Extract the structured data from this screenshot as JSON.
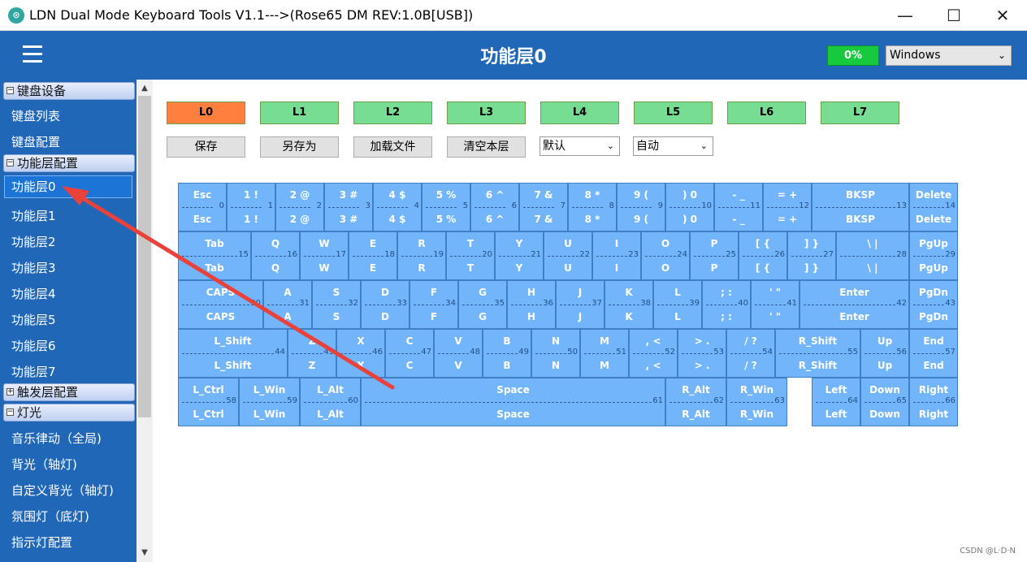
{
  "window": {
    "title": "LDN Dual Mode Keyboard Tools V1.1--->(Rose65 DM REV:1.0B[USB])",
    "minimize": "—",
    "maximize": "☐",
    "close": "✕"
  },
  "header": {
    "page_title": "功能层0",
    "progress": "0%",
    "os_select": "Windows"
  },
  "sidebar": {
    "groups": [
      {
        "label": "键盘设备",
        "toggle": "−"
      },
      {
        "label": "功能层配置",
        "toggle": "−"
      },
      {
        "label": "触发层配置",
        "toggle": "+"
      },
      {
        "label": "灯光",
        "toggle": "−"
      }
    ],
    "keyboard_items": [
      "键盘列表",
      "键盘配置"
    ],
    "layer_items": [
      "功能层0",
      "功能层1",
      "功能层2",
      "功能层3",
      "功能层4",
      "功能层5",
      "功能层6",
      "功能层7"
    ],
    "light_items": [
      "音乐律动（全局)",
      "背光（轴灯)",
      "自定义背光（轴灯)",
      "氛围灯（底灯)",
      "指示灯配置"
    ]
  },
  "layers": [
    {
      "label": "L0",
      "color": "#fe7f3e"
    },
    {
      "label": "L1",
      "color": "#76dd92"
    },
    {
      "label": "L2",
      "color": "#76dd92"
    },
    {
      "label": "L3",
      "color": "#76dd92"
    },
    {
      "label": "L4",
      "color": "#76dd92"
    },
    {
      "label": "L5",
      "color": "#76dd92"
    },
    {
      "label": "L6",
      "color": "#76dd92"
    },
    {
      "label": "L7",
      "color": "#76dd92"
    }
  ],
  "actions": {
    "save": "保存",
    "save_as": "另存为",
    "load_file": "加载文件",
    "clear_layer": "清空本层",
    "mode_select": "默认",
    "auto_select": "自动"
  },
  "keys": [
    {
      "top": "Esc",
      "bottom": "Esc",
      "num": "0"
    },
    {
      "top": "1 !",
      "bottom": "1 !",
      "num": "1"
    },
    {
      "top": "2 @",
      "bottom": "2 @",
      "num": "2"
    },
    {
      "top": "3 #",
      "bottom": "3 #",
      "num": "3"
    },
    {
      "top": "4 $",
      "bottom": "4 $",
      "num": "4"
    },
    {
      "top": "5 %",
      "bottom": "5 %",
      "num": "5"
    },
    {
      "top": "6 ^",
      "bottom": "6 ^",
      "num": "6"
    },
    {
      "top": "7 &",
      "bottom": "7 &",
      "num": "7"
    },
    {
      "top": "8 *",
      "bottom": "8 *",
      "num": "8"
    },
    {
      "top": "9 (",
      "bottom": "9 (",
      "num": "9"
    },
    {
      "top": ") 0",
      "bottom": ") 0",
      "num": "10"
    },
    {
      "top": "- _",
      "bottom": "- _",
      "num": "11"
    },
    {
      "top": "= +",
      "bottom": "= +",
      "num": "12"
    },
    {
      "top": "BKSP",
      "bottom": "BKSP",
      "num": "13"
    },
    {
      "top": "Delete",
      "bottom": "Delete",
      "num": "14"
    },
    {
      "top": "Tab",
      "bottom": "Tab",
      "num": "15"
    },
    {
      "top": "Q",
      "bottom": "Q",
      "num": "16"
    },
    {
      "top": "W",
      "bottom": "W",
      "num": "17"
    },
    {
      "top": "E",
      "bottom": "E",
      "num": "18"
    },
    {
      "top": "R",
      "bottom": "R",
      "num": "19"
    },
    {
      "top": "T",
      "bottom": "T",
      "num": "20"
    },
    {
      "top": "Y",
      "bottom": "Y",
      "num": "21"
    },
    {
      "top": "U",
      "bottom": "U",
      "num": "22"
    },
    {
      "top": "I",
      "bottom": "I",
      "num": "23"
    },
    {
      "top": "O",
      "bottom": "O",
      "num": "24"
    },
    {
      "top": "P",
      "bottom": "P",
      "num": "25"
    },
    {
      "top": "[ {",
      "bottom": "[ {",
      "num": "26"
    },
    {
      "top": "] }",
      "bottom": "] }",
      "num": "27"
    },
    {
      "top": "\\ |",
      "bottom": "\\ |",
      "num": "28"
    },
    {
      "top": "PgUp",
      "bottom": "PgUp",
      "num": "29"
    },
    {
      "top": "CAPS",
      "bottom": "CAPS",
      "num": "30"
    },
    {
      "top": "A",
      "bottom": "A",
      "num": "31"
    },
    {
      "top": "S",
      "bottom": "S",
      "num": "32"
    },
    {
      "top": "D",
      "bottom": "D",
      "num": "33"
    },
    {
      "top": "F",
      "bottom": "F",
      "num": "34"
    },
    {
      "top": "G",
      "bottom": "G",
      "num": "35"
    },
    {
      "top": "H",
      "bottom": "H",
      "num": "36"
    },
    {
      "top": "J",
      "bottom": "J",
      "num": "37"
    },
    {
      "top": "K",
      "bottom": "K",
      "num": "38"
    },
    {
      "top": "L",
      "bottom": "L",
      "num": "39"
    },
    {
      "top": "; :",
      "bottom": "; :",
      "num": "40"
    },
    {
      "top": "' \"",
      "bottom": "' \"",
      "num": "41"
    },
    {
      "top": "Enter",
      "bottom": "Enter",
      "num": "42"
    },
    {
      "top": "PgDn",
      "bottom": "PgDn",
      "num": "43"
    },
    {
      "top": "L_Shift",
      "bottom": "L_Shift",
      "num": "44"
    },
    {
      "top": "Z",
      "bottom": "Z",
      "num": "45"
    },
    {
      "top": "X",
      "bottom": "X",
      "num": "46"
    },
    {
      "top": "C",
      "bottom": "C",
      "num": "47"
    },
    {
      "top": "V",
      "bottom": "V",
      "num": "48"
    },
    {
      "top": "B",
      "bottom": "B",
      "num": "49"
    },
    {
      "top": "N",
      "bottom": "N",
      "num": "50"
    },
    {
      "top": "M",
      "bottom": "M",
      "num": "51"
    },
    {
      "top": ", <",
      "bottom": ", <",
      "num": "52"
    },
    {
      "top": "> .",
      "bottom": "> .",
      "num": "53"
    },
    {
      "top": "/ ?",
      "bottom": "/ ?",
      "num": "54"
    },
    {
      "top": "R_Shift",
      "bottom": "R_Shift",
      "num": "55"
    },
    {
      "top": "Up",
      "bottom": "Up",
      "num": "56"
    },
    {
      "top": "End",
      "bottom": "End",
      "num": "57"
    },
    {
      "top": "L_Ctrl",
      "bottom": "L_Ctrl",
      "num": "58"
    },
    {
      "top": "L_Win",
      "bottom": "L_Win",
      "num": "59"
    },
    {
      "top": "L_Alt",
      "bottom": "L_Alt",
      "num": "60"
    },
    {
      "top": "Space",
      "bottom": "Space",
      "num": "61"
    },
    {
      "top": "R_Alt",
      "bottom": "R_Alt",
      "num": "62"
    },
    {
      "top": "R_Win",
      "bottom": "R_Win",
      "num": "63"
    },
    {
      "top": "Left",
      "bottom": "Left",
      "num": "64"
    },
    {
      "top": "Down",
      "bottom": "Down",
      "num": "65"
    },
    {
      "top": "Right",
      "bottom": "Right",
      "num": "66"
    }
  ],
  "watermark": "CSDN @L·D·N",
  "annotation_color": "#e8423a"
}
